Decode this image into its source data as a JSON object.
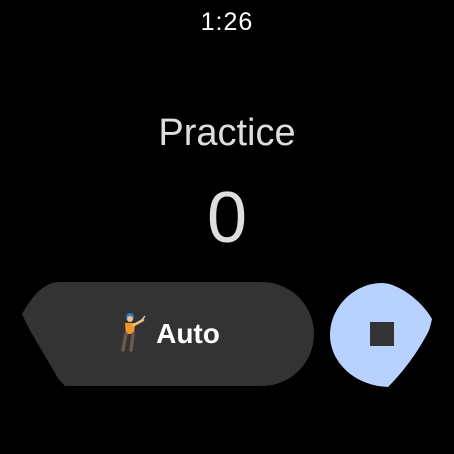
{
  "status_bar": {
    "time": "1:26"
  },
  "main": {
    "mode_label": "Practice",
    "swing_count": "0"
  },
  "actions": {
    "auto_label": "Auto",
    "auto_icon": "golfer-icon",
    "stop_icon": "stop-icon"
  },
  "colors": {
    "background": "#000000",
    "button_dark": "#333333",
    "stop_accent": "#b8d2ff",
    "stop_square": "#333333",
    "golfer_shirt": "#f2962e",
    "golfer_cap": "#2f7bd6"
  }
}
